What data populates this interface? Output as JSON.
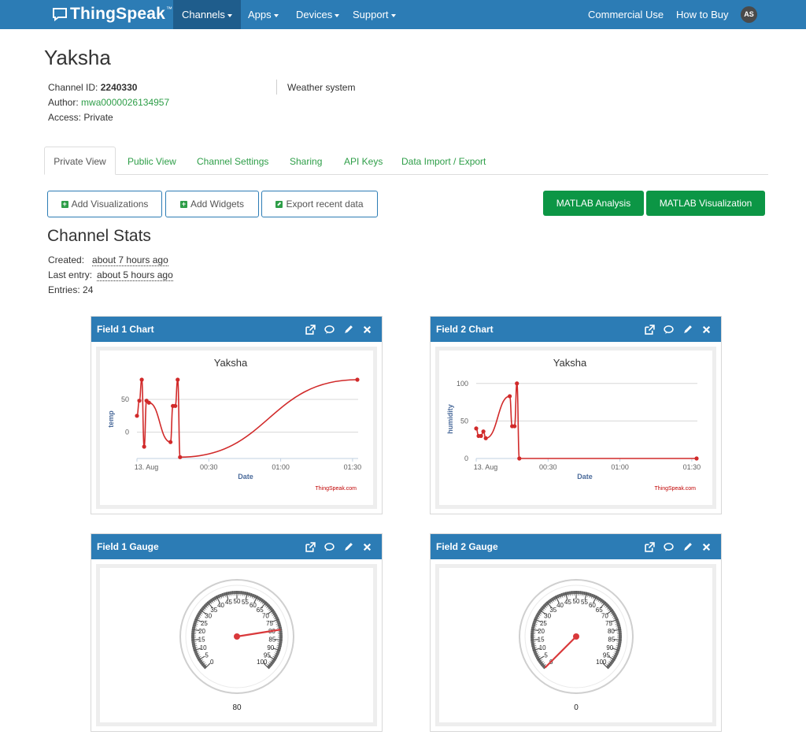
{
  "nav": {
    "logo": "ThingSpeak",
    "logo_tm": "™",
    "items": [
      "Channels",
      "Apps",
      "Devices",
      "Support"
    ],
    "right": [
      "Commercial Use",
      "How to Buy"
    ],
    "avatar": "AS"
  },
  "channel": {
    "title": "Yaksha",
    "id_label": "Channel ID:",
    "id": "2240330",
    "author_label": "Author:",
    "author": "mwa0000026134957",
    "access_label": "Access:",
    "access": "Private",
    "description": "Weather system"
  },
  "tabs": [
    "Private View",
    "Public View",
    "Channel Settings",
    "Sharing",
    "API Keys",
    "Data Import / Export"
  ],
  "buttons": {
    "add_visualizations": "Add Visualizations",
    "add_widgets": "Add Widgets",
    "export": "Export recent data",
    "matlab_analysis": "MATLAB Analysis",
    "matlab_visualization": "MATLAB Visualization"
  },
  "stats": {
    "title": "Channel Stats",
    "created_label": "Created:",
    "created": "about 7 hours ago",
    "last_entry_label": "Last entry:",
    "last_entry": "about 5 hours ago",
    "entries_label": "Entries:",
    "entries": "24"
  },
  "widgets": {
    "field1_chart": "Field 1 Chart",
    "field2_chart": "Field 2 Chart",
    "field1_gauge": "Field 1 Gauge",
    "field2_gauge": "Field 2 Gauge"
  },
  "colors": {
    "navbar": "#2c7cb5",
    "accent_green": "#0c9645",
    "link_green": "#2e9e48",
    "series_red": "#d12a2a"
  },
  "chart_data": [
    {
      "type": "line",
      "title": "Yaksha",
      "xlabel": "Date",
      "ylabel": "temp",
      "x_ticks": [
        "13. Aug",
        "00:30",
        "01:00",
        "01:30"
      ],
      "y_ticks": [
        0,
        50
      ],
      "ylim": [
        -40,
        80
      ],
      "credit": "ThingSpeak.com",
      "series": [
        {
          "x_minutes": [
            0,
            1,
            2,
            3,
            4,
            5,
            14,
            15,
            16,
            17,
            18,
            92
          ],
          "values": [
            25,
            48,
            80,
            -22,
            48,
            45,
            -15,
            40,
            40,
            80,
            -38,
            80
          ]
        }
      ]
    },
    {
      "type": "line",
      "title": "Yaksha",
      "xlabel": "Date",
      "ylabel": "humidity",
      "x_ticks": [
        "13. Aug",
        "00:30",
        "01:00",
        "01:30"
      ],
      "y_ticks": [
        0,
        50,
        100
      ],
      "ylim": [
        0,
        105
      ],
      "credit": "ThingSpeak.com",
      "series": [
        {
          "x_minutes": [
            0,
            1,
            2,
            3,
            4,
            14,
            15,
            16,
            17,
            18,
            92
          ],
          "values": [
            40,
            30,
            30,
            36,
            27,
            83,
            43,
            43,
            100,
            0,
            0
          ]
        }
      ]
    }
  ],
  "gauges": [
    {
      "value": 80,
      "label": "80",
      "min": 0,
      "max": 100,
      "ticks": [
        "0",
        "5",
        "10",
        "15",
        "20",
        "25",
        "30",
        "35",
        "40",
        "45",
        "50",
        "55",
        "60",
        "65",
        "70",
        "75",
        "80",
        "85",
        "90",
        "95",
        "100"
      ]
    },
    {
      "value": 0,
      "label": "0",
      "min": 0,
      "max": 100,
      "ticks": [
        "0",
        "5",
        "10",
        "15",
        "20",
        "25",
        "30",
        "35",
        "40",
        "45",
        "50",
        "55",
        "60",
        "65",
        "70",
        "75",
        "80",
        "85",
        "90",
        "95",
        "100"
      ]
    }
  ]
}
